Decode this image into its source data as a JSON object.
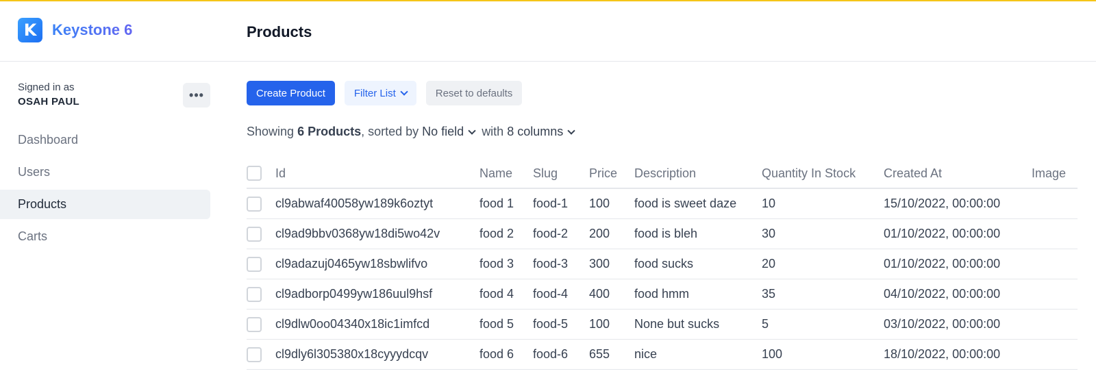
{
  "app": {
    "brand_initial": "K",
    "brand_name": "Keystone 6",
    "page_title": "Products"
  },
  "sidebar": {
    "signed_in_label": "Signed in as",
    "user_name": "OSAH PAUL",
    "more_icon": "•••",
    "items": [
      {
        "label": "Dashboard",
        "active": false
      },
      {
        "label": "Users",
        "active": false
      },
      {
        "label": "Products",
        "active": true
      },
      {
        "label": "Carts",
        "active": false
      }
    ]
  },
  "toolbar": {
    "create_label": "Create Product",
    "filter_label": "Filter List",
    "reset_label": "Reset to defaults"
  },
  "summary": {
    "showing": "Showing",
    "count": "6 Products",
    "sorted_by": ", sorted by",
    "sort_field": "No field",
    "with": "with",
    "columns": "8 columns"
  },
  "table": {
    "headers": [
      "Id",
      "Name",
      "Slug",
      "Price",
      "Description",
      "Quantity In Stock",
      "Created At",
      "Image"
    ],
    "rows": [
      {
        "id": "cl9abwaf40058yw189k6oztyt",
        "name": "food 1",
        "slug": "food-1",
        "price": "100",
        "description": "food is sweet daze",
        "quantity": "10",
        "created_at": "15/10/2022, 00:00:00",
        "image": ""
      },
      {
        "id": "cl9ad9bbv0368yw18di5wo42v",
        "name": "food 2",
        "slug": "food-2",
        "price": "200",
        "description": "food is bleh",
        "quantity": "30",
        "created_at": "01/10/2022, 00:00:00",
        "image": ""
      },
      {
        "id": "cl9adazuj0465yw18sbwlifvo",
        "name": "food 3",
        "slug": "food-3",
        "price": "300",
        "description": "food sucks",
        "quantity": "20",
        "created_at": "01/10/2022, 00:00:00",
        "image": ""
      },
      {
        "id": "cl9adborp0499yw186uul9hsf",
        "name": "food 4",
        "slug": "food-4",
        "price": "400",
        "description": "food hmm",
        "quantity": "35",
        "created_at": "04/10/2022, 00:00:00",
        "image": ""
      },
      {
        "id": "cl9dlw0oo04340x18ic1imfcd",
        "name": "food 5",
        "slug": "food-5",
        "price": "100",
        "description": "None but sucks",
        "quantity": "5",
        "created_at": "03/10/2022, 00:00:00",
        "image": ""
      },
      {
        "id": "cl9dly6l305380x18cyyydcqv",
        "name": "food 6",
        "slug": "food-6",
        "price": "655",
        "description": "nice",
        "quantity": "100",
        "created_at": "18/10/2022, 00:00:00",
        "image": ""
      }
    ]
  }
}
